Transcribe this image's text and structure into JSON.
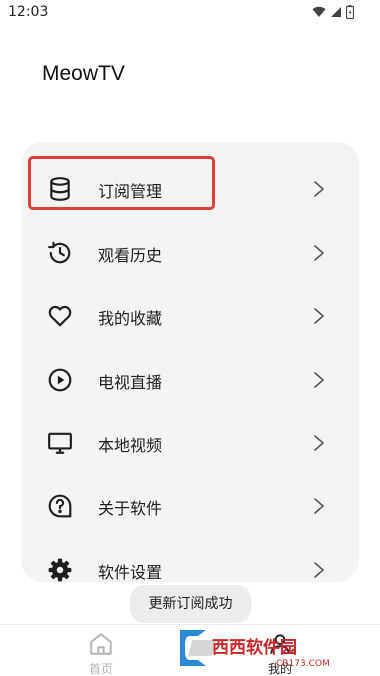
{
  "status_bar": {
    "time": "12:03"
  },
  "app": {
    "title": "MeowTV"
  },
  "menu": {
    "items": [
      {
        "label": "订阅管理",
        "icon": "database-icon"
      },
      {
        "label": "观看历史",
        "icon": "history-icon"
      },
      {
        "label": "我的收藏",
        "icon": "heart-icon"
      },
      {
        "label": "电视直播",
        "icon": "play-circle-icon"
      },
      {
        "label": "本地视频",
        "icon": "monitor-icon"
      },
      {
        "label": "关于软件",
        "icon": "help-circle-icon"
      },
      {
        "label": "软件设置",
        "icon": "gear-icon"
      }
    ]
  },
  "toast": {
    "text": "更新订阅成功"
  },
  "bottom_nav": {
    "items": [
      {
        "label": "首页",
        "icon": "home-icon",
        "active": false
      },
      {
        "label": "我的",
        "icon": "user-icon",
        "active": true
      }
    ]
  },
  "watermark": {
    "text": "西西软件园",
    "site": "CR173.COM"
  },
  "colors": {
    "card_background": "#f4f4f4",
    "highlight_border": "#d9413a",
    "inactive_nav": "#b3b3b3",
    "watermark_red": "#c8282a"
  }
}
